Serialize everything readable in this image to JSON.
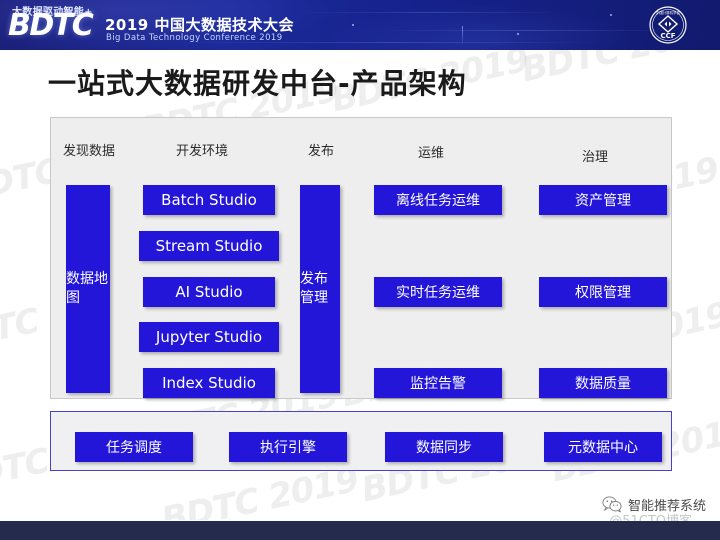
{
  "header": {
    "tagline": "大数据驱动智能+",
    "logo": "BDTC",
    "conference_cn": "2019 中国大数据技术大会",
    "conference_en": "Big Data Technology Conference 2019",
    "org_logo": "ccf-logo",
    "org_logo_text": "CCF",
    "org_logo_cn": "中国计算机学会"
  },
  "slide": {
    "title": "一站式大数据研发中台-产品架构",
    "watermark": "BDTC 2019"
  },
  "architecture": {
    "columns": [
      {
        "id": "discover",
        "label": "发现数据"
      },
      {
        "id": "develop",
        "label": "开发环境"
      },
      {
        "id": "publish",
        "label": "发布"
      },
      {
        "id": "ops",
        "label": "运维"
      },
      {
        "id": "governance",
        "label": "治理"
      }
    ],
    "discover_box": "数据地图",
    "develop_boxes": [
      "Batch Studio",
      "Stream Studio",
      "AI Studio",
      "Jupyter Studio",
      "Index Studio"
    ],
    "publish_box": "发布管理",
    "ops_boxes": [
      "离线任务运维",
      "实时任务运维",
      "监控告警"
    ],
    "governance_boxes": [
      "资产管理",
      "权限管理",
      "数据质量"
    ],
    "foundation_boxes": [
      "任务调度",
      "执行引擎",
      "数据同步",
      "元数据中心"
    ]
  },
  "footer": {
    "wechat_icon": "wechat-icon",
    "account_name": "智能推荐系统",
    "site_watermark": "@51CTO博客"
  },
  "colors": {
    "box_blue": "#2316d8",
    "panel_gray": "#eeeeee",
    "header_blue": "#1b2a9a",
    "footer_navy": "#242b4d"
  }
}
